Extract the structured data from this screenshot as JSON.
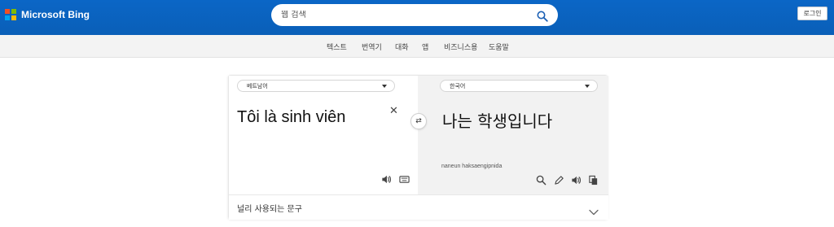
{
  "header": {
    "brand": "Microsoft Bing",
    "logo_colors": [
      "#f25022",
      "#7fba00",
      "#00a4ef",
      "#ffb900"
    ],
    "search_placeholder": "웹 검색",
    "login_label": "로그인"
  },
  "subnav": {
    "items": [
      "텍스트",
      "번역기",
      "대화",
      "앱",
      "비즈니스용",
      "도움말"
    ]
  },
  "translator": {
    "source_language": "베트남어",
    "target_language": "한국어",
    "source_text": "Tôi là sinh viên",
    "translated_text": "나는 학생입니다",
    "transliteration": "naneun haksaengipnida",
    "phrases_label": "널리 사용되는 문구"
  },
  "icons": {
    "search": "search-icon",
    "clear": "close-icon",
    "swap": "swap-icon",
    "speaker": "speaker-icon",
    "keyboard": "keyboard-icon",
    "dictionary": "search-icon",
    "edit": "pencil-icon",
    "copy": "copy-icon",
    "expand": "chevron-down-icon"
  }
}
